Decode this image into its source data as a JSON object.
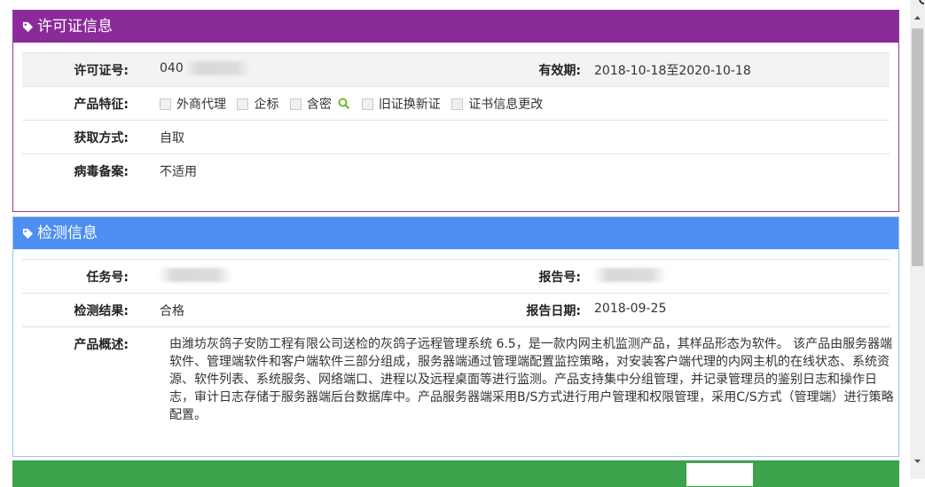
{
  "license": {
    "title": "许可证信息",
    "license_no_label": "许可证号:",
    "license_no_value": "040",
    "validity_label": "有效期:",
    "validity_value": "2018-10-18至2020-10-18",
    "features_label": "产品特征:",
    "features": [
      "外商代理",
      "企标",
      "含密",
      "旧证换新证",
      "证书信息更改"
    ],
    "acquire_label": "获取方式:",
    "acquire_value": "自取",
    "virus_label": "病毒备案:",
    "virus_value": "不适用"
  },
  "detection": {
    "title": "检测信息",
    "task_label": "任务号:",
    "report_no_label": "报告号:",
    "result_label": "检测结果:",
    "result_value": "合格",
    "report_date_label": "报告日期:",
    "report_date_value": "2018-09-25",
    "overview_label": "产品概述:",
    "overview_value": "由潍坊灰鸽子安防工程有限公司送检的灰鸽子远程管理系统 6.5，是一款内网主机监测产品，其样品形态为软件。 该产品由服务器端软件、管理端软件和客户端软件三部分组成，服务器端通过管理端配置监控策略，对安装客户端代理的内网主机的在线状态、系统资源、软件列表、系统服务、网络端口、进程以及远程桌面等进行监测。产品支持集中分组管理，并记录管理员的鉴别日志和操作日志，审计日志存储于服务器端后台数据库中。产品服务器端采用B/S方式进行用户管理和权限管理，采用C/S方式（管理端）进行策略配置。"
  },
  "colors": {
    "license_header": "#8b2b9a",
    "detection_header": "#4d8ff0",
    "next_header": "#3ca24b"
  },
  "icons": [
    "tag-icon",
    "search-icon",
    "scroll-up-icon",
    "scroll-down-icon"
  ]
}
